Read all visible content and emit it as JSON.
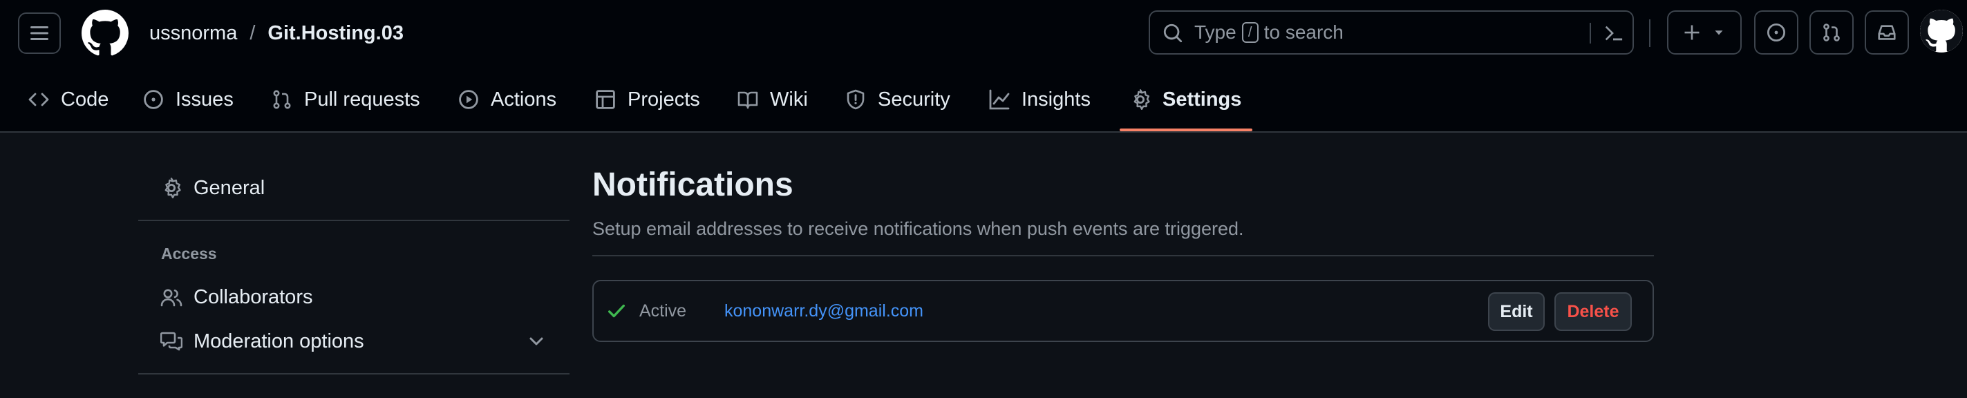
{
  "header": {
    "owner": "ussnorma",
    "separator": "/",
    "repo": "Git.Hosting.03",
    "search_prefix": "Type",
    "search_key": "/",
    "search_suffix": "to search"
  },
  "tabs": [
    {
      "label": "Code",
      "icon": "code-icon"
    },
    {
      "label": "Issues",
      "icon": "issue-opened-icon"
    },
    {
      "label": "Pull requests",
      "icon": "git-pull-request-icon"
    },
    {
      "label": "Actions",
      "icon": "play-icon"
    },
    {
      "label": "Projects",
      "icon": "table-icon"
    },
    {
      "label": "Wiki",
      "icon": "book-icon"
    },
    {
      "label": "Security",
      "icon": "shield-icon"
    },
    {
      "label": "Insights",
      "icon": "graph-icon"
    },
    {
      "label": "Settings",
      "icon": "gear-icon",
      "active": true
    }
  ],
  "sidebar": {
    "general": "General",
    "access_heading": "Access",
    "collaborators": "Collaborators",
    "moderation": "Moderation options"
  },
  "main": {
    "title": "Notifications",
    "description": "Setup email addresses to receive notifications when push events are triggered.",
    "hook": {
      "status": "Active",
      "email": "kononwarr.dy@gmail.com",
      "edit_label": "Edit",
      "delete_label": "Delete"
    }
  },
  "colors": {
    "accent_underline": "#f78166",
    "link": "#4493f8",
    "success": "#3fb950",
    "danger": "#f85149"
  }
}
